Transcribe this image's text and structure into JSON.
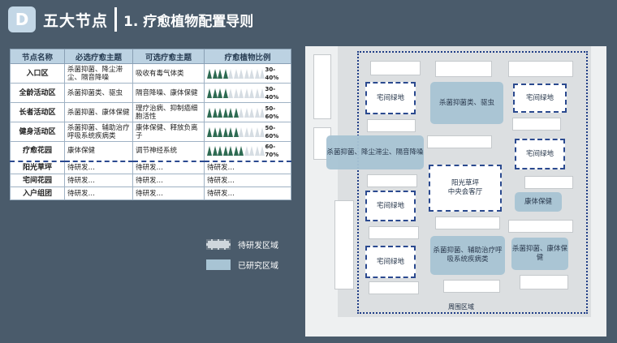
{
  "header": {
    "badge": "D",
    "title": "五大节点",
    "subtitle": "1. 疗愈植物配置导则"
  },
  "table": {
    "headers": [
      "节点名称",
      "必选疗愈主题",
      "可选疗愈主题",
      "疗愈植物比例"
    ],
    "rows": [
      {
        "name": "入口区",
        "required": "杀菌抑菌、降尘滞尘、隔音降噪",
        "optional": "吸收有毒气体类",
        "ratio_text": "30-40%",
        "ratio_value": 0.35
      },
      {
        "name": "全龄活动区",
        "required": "杀菌抑菌类、驱虫",
        "optional": "隔音降噪、康体保健",
        "ratio_text": "30-40%",
        "ratio_value": 0.35
      },
      {
        "name": "长者活动区",
        "required": "杀菌抑菌、康体保健",
        "optional": "理疗治病、抑制癌细胞活性",
        "ratio_text": "50-60%",
        "ratio_value": 0.55
      },
      {
        "name": "健身活动区",
        "required": "杀菌抑菌、辅助治疗呼吸系统疾病类",
        "optional": "康体保健、释放负离子",
        "ratio_text": "50-60%",
        "ratio_value": 0.55
      },
      {
        "name": "疗愈花园",
        "required": "康体保健",
        "optional": "调节神经系统",
        "ratio_text": "60-70%",
        "ratio_value": 0.65
      }
    ],
    "pending_rows": [
      {
        "name": "阳光草坪",
        "c1": "待研发…",
        "c2": "待研发…",
        "c3": "待研发…"
      },
      {
        "name": "宅间花园",
        "c1": "待研发…",
        "c2": "待研发…",
        "c3": "待研发…"
      },
      {
        "name": "入户组团",
        "c1": "待研发…",
        "c2": "待研发…",
        "c3": "待研发…"
      }
    ]
  },
  "legend": {
    "pending": "待研发区域",
    "done": "已研究区域"
  },
  "map": {
    "zones": {
      "yard1": "宅间绿地",
      "antibac_insect": "杀菌抑菌类、驱虫",
      "yard2": "宅间绿地",
      "entrance": "杀菌抑菌、降尘滞尘、隔音降噪",
      "yard3": "宅间绿地",
      "lawn": "阳光草坪\n中央会客厅",
      "yard4": "宅间绿地",
      "health": "康体保健",
      "yard5": "宅间绿地",
      "respiratory": "杀菌抑菌、辅助治疗呼吸系统疾病类",
      "antibac_health": "杀菌抑菌、康体保健"
    },
    "perimeter": "周围区域"
  },
  "colors": {
    "background": "#4a5b6b",
    "badge": "#c3d7e6",
    "table_header": "#bcd2e2",
    "tree": "#2e6b52",
    "researched": "#a8c4d4",
    "pending_border": "#2b4a8f"
  }
}
